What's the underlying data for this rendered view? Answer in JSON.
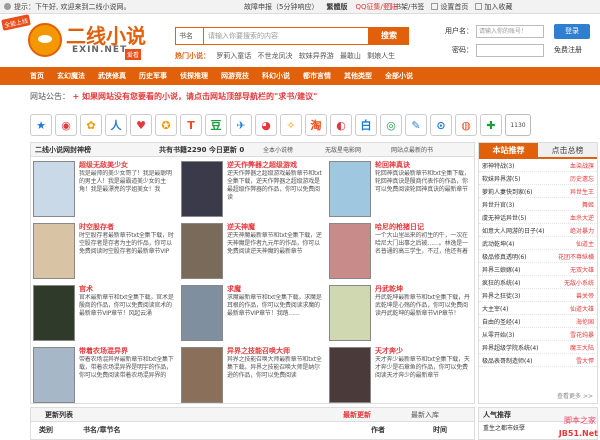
{
  "topbar": {
    "greeting": "提示：下午好, 欢迎来到二线小说网。",
    "links": [
      "故障申报（5分钟响应）",
      "繁體版",
      "QQ征集/登陆"
    ],
    "right_links": [
      "书架/书签",
      "设置首页",
      "加入收藏"
    ]
  },
  "logo": {
    "badge": "全能上线",
    "title": "二线小说",
    "subtitle": "EXIN.NET",
    "tag": "爱看"
  },
  "search": {
    "type": "书名",
    "placeholder": "请输入你要搜索的内容",
    "button": "搜索"
  },
  "hot_words": {
    "label": "热门小说：",
    "items": [
      "罗莉入童话",
      "不世龙凤决",
      "软妹异界游",
      "最敢山",
      "剩娘人生"
    ]
  },
  "login": {
    "user_label": "用户名：",
    "user_placeholder": "请输入你的账号！",
    "pass_label": "密码：",
    "login_btn": "登录",
    "register": "免费注册"
  },
  "nav": [
    "首页",
    "玄幻魔法",
    "武侠修真",
    "历史军事",
    "侦探推理",
    "网游竞技",
    "科幻小说",
    "都市言情",
    "其他类型",
    "全部小说"
  ],
  "notice": {
    "label": "网站公告：",
    "text": "+ 如果网站没有您要看的小说，请点击网站顶部导航栏的\"求书/建议\""
  },
  "icon_bar": {
    "count": "1130",
    "icons": [
      "star-icon",
      "weibo-icon",
      "qzone-icon",
      "renren-icon",
      "heart-icon",
      "star2-icon",
      "t-icon",
      "douban-icon",
      "kaixin-icon",
      "baidu-icon",
      "feiting-icon",
      "tao-icon",
      "sohu-icon",
      "bai-icon",
      "quan-icon",
      "note-icon",
      "lol-icon",
      "rss-icon",
      "plus-icon"
    ]
  },
  "rank": {
    "title": "二线小说网封神榜",
    "count": "共有书籍2290 今日更新 0",
    "tabs": [
      "全本小说榜",
      "无敌星电影网",
      "网站点最新的书",
      "网站最后检测"
    ],
    "books": [
      {
        "name": "超级无敌美少女",
        "desc": "我是最帅的美少女哥了！我是最聪明的男主人！我是最霸道美少女的主角！我是最漂亮的学姐美女！我"
      },
      {
        "name": "逆天作弊器之超级游戏",
        "desc": "逆天作弊器之超级游戏最新章节和txt全集下载，逆天作弊器之超级游戏是最超级作弊器的作品，你可以免费阅读"
      },
      {
        "name": "轮回神真诀",
        "desc": "轮回神真诀最新章节和txt全集下载，轮回神真诀是殷商代表作的作品，你可以免费阅读轮回神真诀的最新章节"
      },
      {
        "name": "时空股存者",
        "desc": "时空股存者最新章节txt全集下载，时空股存者是存者为主的作品，你可以免费阅读时空股存者的最新章节VIP"
      },
      {
        "name": "逆天神魔",
        "desc": "逆天神魔最新章节和txt全集下载，逆天神魔是作者九元年的作品，你可以免费阅读逆天神魔的最新章节"
      },
      {
        "name": "哈尼的枪猪日记",
        "desc": "一个大山里出来的初生的牛，一次在哈尼大门出事之后被……。林逸是一名普通的高三学生，不过，他还有着"
      },
      {
        "name": "官术",
        "desc": "官术最新章节和txt全集下载，官术是殷商的作品，你可以免费阅读官术的最新章节VIP章节！风起云涌"
      },
      {
        "name": "求魔",
        "desc": "求魔最新章节和txt全集下载，求魔是耳根的作品，你可以免费阅读求魔的最新章节VIP章节！我踏……"
      },
      {
        "name": "丹武乾坤",
        "desc": "丹武乾坤最新章节和txt全集下载，丹武乾坤是心殇的作品，你可以免费阅读丹武乾坤的最新章节VIP章节！"
      },
      {
        "name": "带着农场混异界",
        "desc": "带着农场混异界最新章节和txt全集下载，带着农场混异界是明宇的作品，你可以免费阅读带着农场混异界的"
      },
      {
        "name": "异界之技能召唤大师",
        "desc": "异界之技能召唤大师最新章节和txt全集下载，异界之技能召唤大师是纳尔逊的作品，你可以免费阅读"
      },
      {
        "name": "天才奔少",
        "desc": "天才奔少最新章节和txt全集下载，天才奔少是石章鱼的作品，你可以免费阅读天才奔少的最新章节"
      }
    ]
  },
  "sidebar": {
    "tabs": [
      "本站推荐",
      "点击总榜"
    ],
    "items": [
      {
        "left": "邪神特战(3)",
        "right": "血染战旗"
      },
      {
        "left": "软妹异界游(5)",
        "right": "历史遗忘"
      },
      {
        "left": "萝莉人妻快到家(6)",
        "right": "异世生王"
      },
      {
        "left": "异世升官(3)",
        "right": "舞姬"
      },
      {
        "left": "虞无神话异世(5)",
        "right": "血杀大逆"
      },
      {
        "left": "如意大人网游的日子(4)",
        "right": "绝对暴力"
      },
      {
        "left": "武动乾坤(4)",
        "right": "仙道主"
      },
      {
        "left": "极品修真透明(6)",
        "right": "花团不尊纵横"
      },
      {
        "left": "异界三娘嫁(4)",
        "right": "无双大雄"
      },
      {
        "left": "疯狂的系统(4)",
        "right": "无敌小系统"
      },
      {
        "left": "异界之狂徒(3)",
        "right": "兽关帝"
      },
      {
        "left": "大主宰(4)",
        "right": "仙道大雄"
      },
      {
        "left": "自由的圣经(4)",
        "right": "海伦国"
      },
      {
        "left": "从零开始(3)",
        "right": "雪花纯暴"
      },
      {
        "left": "异界超级学院系统(4)",
        "right": "魔王大陆"
      },
      {
        "left": "极品表哥制造师(4)",
        "right": "雪大悍"
      }
    ],
    "more": "查看更多 >>"
  },
  "updates": {
    "title": "更新列表",
    "tabs": [
      "最新更新",
      "最新入库"
    ],
    "columns": [
      "类别",
      "书名/章节名",
      "作者",
      "时间"
    ]
  },
  "hot_rec": {
    "title": "人气推荐",
    "line": "重生之都市妖孽"
  },
  "watermark": {
    "a": "脚本之家",
    "b": "JB51.Net"
  }
}
